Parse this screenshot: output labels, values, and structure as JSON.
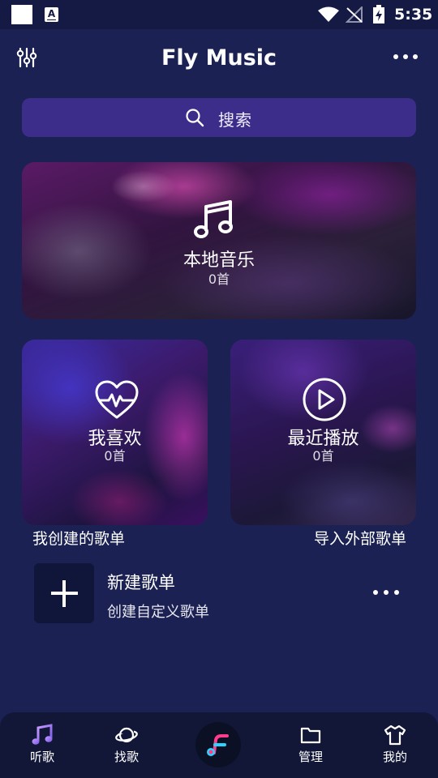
{
  "status_bar": {
    "time": "5:35",
    "notification_icon_letter": "A",
    "icons": [
      "white-square-icon",
      "a-notification-icon",
      "wifi-icon",
      "no-signal-icon",
      "battery-icon"
    ]
  },
  "header": {
    "title": "Fly Music",
    "left_icon": "equalizer-icon",
    "right_icon": "more-icon"
  },
  "search": {
    "label": "搜索",
    "icon": "search-icon"
  },
  "cards": {
    "local": {
      "title": "本地音乐",
      "count": "0首",
      "icon": "music-note-icon"
    },
    "like": {
      "title": "我喜欢",
      "count": "0首",
      "icon": "heart-pulse-icon"
    },
    "recent": {
      "title": "最近播放",
      "count": "0首",
      "icon": "play-circle-icon"
    }
  },
  "sections": {
    "my_playlists": "我创建的歌单",
    "import": "导入外部歌单"
  },
  "new_playlist": {
    "title": "新建歌单",
    "subtitle": "创建自定义歌单",
    "icon": "plus-icon"
  },
  "bottom_nav": {
    "items": [
      {
        "label": "听歌",
        "icon": "music-note-icon"
      },
      {
        "label": "找歌",
        "icon": "planet-icon"
      },
      {
        "label": "",
        "icon": "fly-logo-icon"
      },
      {
        "label": "管理",
        "icon": "folder-icon"
      },
      {
        "label": "我的",
        "icon": "tshirt-icon"
      }
    ]
  },
  "colors": {
    "background": "#1b2152",
    "search_bar": "#3c2d8a",
    "nav_background": "#121737",
    "accent_purple": "#a06cf0",
    "logo_pink": "#ff3d8b",
    "logo_cyan": "#2ad4ff"
  }
}
